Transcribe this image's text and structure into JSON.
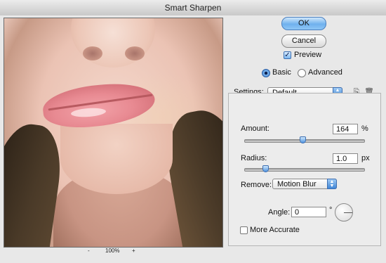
{
  "window": {
    "title": "Smart Sharpen"
  },
  "preview": {
    "zoom_out": "-",
    "zoom_level": "100%",
    "zoom_in": "+"
  },
  "buttons": {
    "ok": "OK",
    "cancel": "Cancel"
  },
  "preview_toggle": {
    "label": "Preview",
    "checked": true
  },
  "mode": {
    "basic": "Basic",
    "advanced": "Advanced",
    "selected": "Basic"
  },
  "settings": {
    "label": "Settings:",
    "value": "Default"
  },
  "amount": {
    "label": "Amount:",
    "value": "164",
    "unit": "%",
    "slider_fraction": 0.49
  },
  "radius": {
    "label": "Radius:",
    "value": "1.0",
    "unit": "px",
    "slider_fraction": 0.18
  },
  "remove": {
    "label": "Remove:",
    "value": "Motion Blur"
  },
  "angle": {
    "label": "Angle:",
    "value": "0",
    "unit": "°"
  },
  "more_accurate": {
    "label": "More Accurate",
    "checked": false
  },
  "icons": {
    "save": "save-settings-icon",
    "delete": "trash-icon"
  },
  "colors": {
    "accent": "#4f93df",
    "default_button": "#6fb1ee"
  }
}
